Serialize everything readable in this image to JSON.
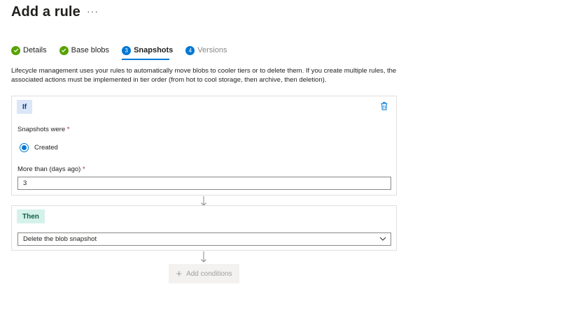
{
  "page": {
    "title": "Add a rule",
    "more_label": "···"
  },
  "steps": [
    {
      "label": "Details",
      "state": "done",
      "icon": "check-icon"
    },
    {
      "label": "Base blobs",
      "state": "done",
      "icon": "check-icon"
    },
    {
      "label": "Snapshots",
      "state": "current",
      "number": "3"
    },
    {
      "label": "Versions",
      "state": "upcoming",
      "number": "4"
    }
  ],
  "description": "Lifecycle management uses your rules to automatically move blobs to cooler tiers or to delete them. If you create multiple rules, the associated actions must be implemented in tier order (from hot to cool storage, then archive, then deletion).",
  "if_block": {
    "tag": "If",
    "snapshots_label": "Snapshots were",
    "required_mark": "*",
    "radio_option": "Created",
    "days_label": "More than (days ago)",
    "days_value": "3"
  },
  "then_block": {
    "tag": "Then",
    "action_value": "Delete the blob snapshot"
  },
  "add_conditions_label": "Add conditions",
  "colors": {
    "accent": "#0078d4",
    "done": "#57a300",
    "if_tag_bg": "#dbe6f8",
    "then_tag_bg": "#d5f2ea"
  }
}
